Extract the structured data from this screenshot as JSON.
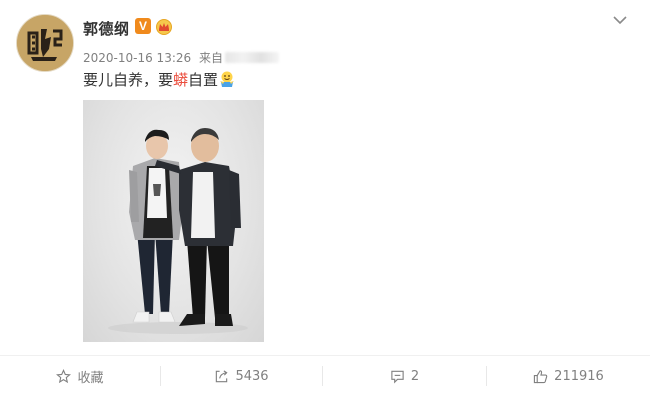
{
  "post": {
    "user_name": "郭德纲",
    "vip_badge": "V",
    "timestamp": "2020-10-16 13:26",
    "source_prefix": "来自",
    "text_part1": "要儿自养，要",
    "text_highlight": "蟒",
    "text_part2": "自置"
  },
  "icons": {
    "verified": "vip-v-badge",
    "crown": "crown-icon",
    "more": "chevron-down-icon",
    "emoji": "emoji-icon",
    "favorite": "star-icon",
    "repost": "share-icon",
    "comment": "comment-icon",
    "like": "thumbs-up-icon"
  },
  "actions": {
    "favorite_label": "收藏",
    "repost_count": "5436",
    "comment_count": "2",
    "like_count": "211916"
  },
  "colors": {
    "highlight": "#eb4d3d",
    "vip": "#f08a1c",
    "text": "#333333",
    "muted": "#808080"
  }
}
